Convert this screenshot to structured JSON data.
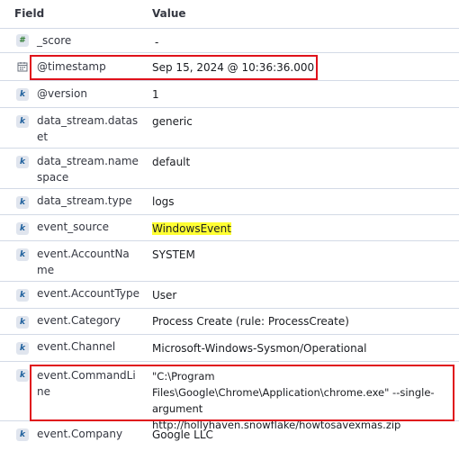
{
  "header": {
    "field_label": "Field",
    "value_label": "Value"
  },
  "rows": [
    {
      "field": "_score",
      "value": "-"
    },
    {
      "field": "@timestamp",
      "value": "Sep 15, 2024 @ 10:36:36.000"
    },
    {
      "field": "@version",
      "value": "1"
    },
    {
      "field": "data_stream.dataset",
      "value": "generic"
    },
    {
      "field": "data_stream.namespace",
      "value": "default"
    },
    {
      "field": "data_stream.type",
      "value": "logs"
    },
    {
      "field": "event_source",
      "value": "WindowsEvent"
    },
    {
      "field": "event.AccountName",
      "value": "SYSTEM"
    },
    {
      "field": "event.AccountType",
      "value": "User"
    },
    {
      "field": "event.Category",
      "value": "Process Create (rule: ProcessCreate)"
    },
    {
      "field": "event.Channel",
      "value": "Microsoft-Windows-Sysmon/Operational"
    },
    {
      "field": "event.CommandLine",
      "value": "\"C:\\Program Files\\Google\\Chrome\\Application\\chrome.exe\" --single-argument http://hollyhaven.snowflake/howtosavexmas.zip"
    },
    {
      "field": "event.Company",
      "value": "Google LLC"
    }
  ],
  "icons": {
    "number": "hash-icon",
    "date": "calendar-icon",
    "keyword": "keyword-k-icon"
  },
  "colors": {
    "highlight": "#ffff33",
    "annotation_box": "#e0121b"
  }
}
